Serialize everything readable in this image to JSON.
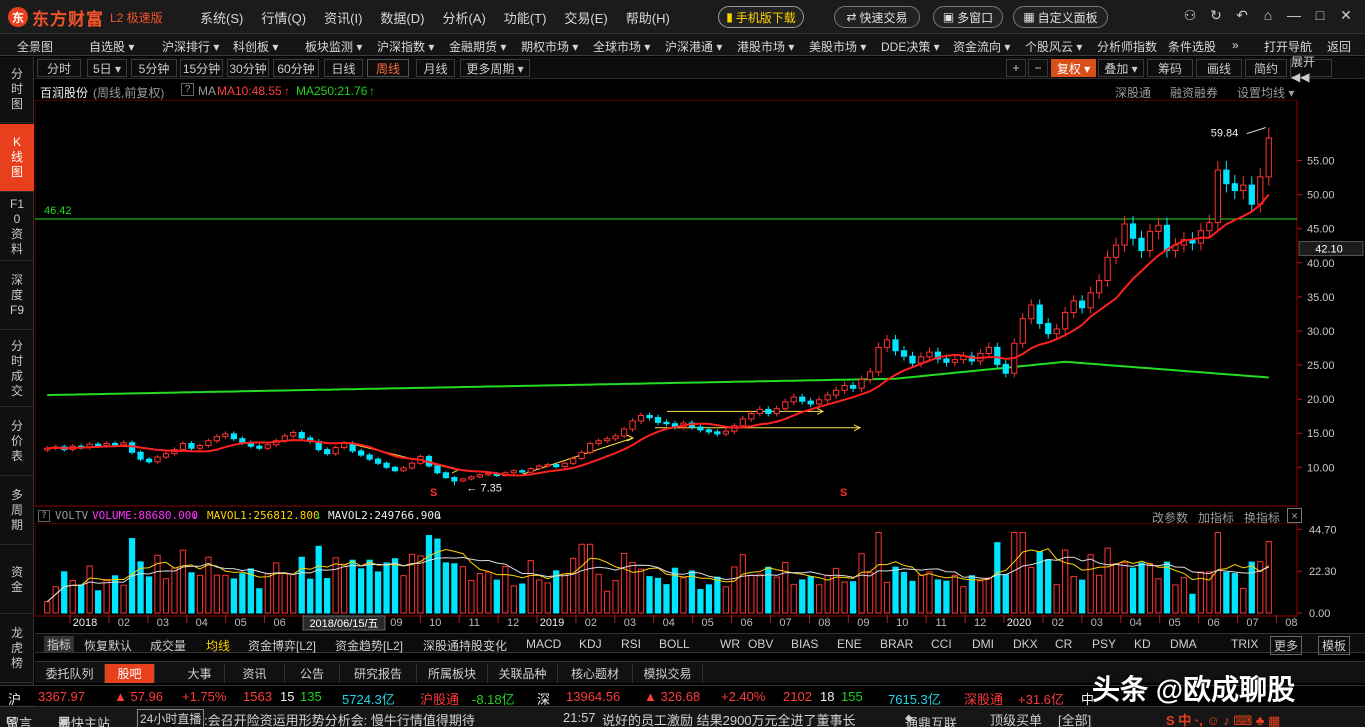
{
  "app": {
    "logo_mark": "东",
    "name": "东方财富",
    "version": "L2 极速版"
  },
  "top_menu": [
    "系统(S)",
    "行情(Q)",
    "资讯(I)",
    "数据(D)",
    "分析(A)",
    "功能(T)",
    "交易(E)",
    "帮助(H)"
  ],
  "top_buttons": {
    "mobile": "手机版下载",
    "quick_trade": "快速交易",
    "multi_window": "多窗口",
    "custom_panel": "自定义面板"
  },
  "window_icons": [
    "user-icon",
    "refresh-icon",
    "back-icon",
    "shirt-icon",
    "minimize-icon",
    "maximize-icon",
    "close-icon"
  ],
  "nav_menu": [
    {
      "label": "全景图",
      "x": 17
    },
    {
      "label": "自选股 ▾",
      "x": 89
    },
    {
      "label": "沪深排行 ▾",
      "x": 162
    },
    {
      "label": "科创板 ▾",
      "x": 233
    },
    {
      "label": "板块监测 ▾",
      "x": 305
    },
    {
      "label": "沪深指数 ▾",
      "x": 377
    },
    {
      "label": "金融期货 ▾",
      "x": 449
    },
    {
      "label": "期权市场 ▾",
      "x": 521
    },
    {
      "label": "全球市场 ▾",
      "x": 593
    },
    {
      "label": "沪深港通 ▾",
      "x": 665
    },
    {
      "label": "港股市场 ▾",
      "x": 737
    },
    {
      "label": "美股市场 ▾",
      "x": 809
    },
    {
      "label": "DDE决策 ▾",
      "x": 881
    },
    {
      "label": "资金流向 ▾",
      "x": 953
    },
    {
      "label": "个股风云 ▾",
      "x": 1025
    },
    {
      "label": "分析师指数",
      "x": 1097
    },
    {
      "label": "条件选股",
      "x": 1168
    },
    {
      "label": "»",
      "x": 1232
    },
    {
      "label": "打开导航",
      "x": 1264
    },
    {
      "label": "返回",
      "x": 1327
    }
  ],
  "left_tabs": [
    "分时图",
    "K线图",
    "F10资料",
    "深度F9",
    "分时成交",
    "分价表",
    "多周期",
    "资金",
    "龙虎榜"
  ],
  "period_bar": {
    "periods": [
      "分时",
      "5日 ▾",
      "5分钟",
      "15分钟",
      "30分钟",
      "60分钟",
      "日线",
      "周线",
      "月线",
      "更多周期 ▾"
    ],
    "active": "周线",
    "right_tools": [
      "+",
      "−",
      "复权 ▾",
      "叠加 ▾",
      "筹码",
      "画线",
      "简约",
      "展开 ◀◀"
    ]
  },
  "chart_header": {
    "stock": "百润股份",
    "mode": "(周线,前复权)",
    "help": "?",
    "ma_label": "MA",
    "ma10": "MA10:48.55",
    "ma250": "MA250:21.76",
    "links": [
      "深股通",
      "融资融券",
      "设置均线 ▾"
    ]
  },
  "annotations": {
    "high_label": "59.84",
    "low_label": "7.35",
    "hline_label": "46.42",
    "current_price": "42.10",
    "s_marker": "S"
  },
  "vol_header": {
    "help": "?",
    "name": "VOLTV",
    "volume": "VOLUME:88680.000",
    "mavol1": "MAVOL1:256812.800",
    "mavol2": "MAVOL2:249766.900",
    "links": [
      "改参数",
      "加指标",
      "换指标"
    ],
    "close": "✕"
  },
  "tooltip_date": "2018/06/15/五",
  "indicator_bar": {
    "items": [
      "指标",
      "恢复默认",
      "成交量",
      "均线",
      "资金博弈[L2]",
      "资金趋势[L2]",
      "深股通持股变化",
      "MACD",
      "KDJ",
      "RSI",
      "BOLL",
      "WR",
      "OBV",
      "BIAS",
      "ENE",
      "BRAR",
      "CCI",
      "DMI",
      "DKX",
      "CR",
      "PSY",
      "KD",
      "DMA",
      "TRIX",
      "更多",
      "模板"
    ]
  },
  "bottom_tabs": [
    "委托队列",
    "股吧",
    "大事",
    "资讯",
    "公告",
    "研究报告",
    "所属板块",
    "关联品种",
    "核心题材",
    "模拟交易"
  ],
  "bottom_active": "股吧",
  "index_strip": {
    "sh_label": "沪",
    "sh_price": "3367.97",
    "sh_change": "▲ 57.96",
    "sh_pct": "+1.75%",
    "sh_up": "1563",
    "sh_flat": "15",
    "sh_down": "135",
    "sh_amount": "5724.3亿",
    "hgt_label": "沪股通",
    "hgt_value": "-8.18亿",
    "sz_label": "深",
    "sz_price": "13964.56",
    "sz_change": "▲ 326.68",
    "sz_pct": "+2.40%",
    "sz_up": "2102",
    "sz_flat": "18",
    "sz_down": "155",
    "sz_amount": "7615.3亿",
    "sgt_label": "深股通",
    "sgt_value": "+31.6亿",
    "zh_label": "中"
  },
  "status": {
    "leave_msg": "留言",
    "top_site": "最快主站",
    "live": "24小时直播",
    "news1": ":会召开险资运用形势分析会: 慢牛行情值得期待",
    "time": "21:57",
    "news2": "说好的员工激励 结果2900万元全进了董事长",
    "broker": "通鼎互联",
    "top_buy": "顶级买单",
    "filter": "[全部]"
  },
  "watermark": "头条 @欧成聊股",
  "colors": {
    "up": "#ff3232",
    "down": "#00e5ff",
    "ma10": "#ff2020",
    "ma250": "#22dd22",
    "accent": "#e8401c"
  },
  "chart_data": {
    "type": "candlestick",
    "title": "百润股份 (周线,前复权)",
    "period": "weekly",
    "price_axis": {
      "ticks": [
        10,
        15,
        20,
        25,
        30,
        35,
        40,
        45,
        50,
        55
      ],
      "ylim": [
        5.5,
        63
      ]
    },
    "volume_axis": {
      "ticks": [
        "0.00",
        "22.30",
        "44.70"
      ],
      "ylim": [
        0,
        47
      ]
    },
    "x_ticks": [
      "2018",
      "02",
      "03",
      "04",
      "05",
      "06",
      "07",
      "08",
      "09",
      "10",
      "11",
      "12",
      "2019",
      "02",
      "03",
      "04",
      "05",
      "06",
      "07",
      "08",
      "09",
      "10",
      "11",
      "12",
      "2020",
      "02",
      "03",
      "04",
      "05",
      "06",
      "07",
      "08"
    ],
    "highest": 59.84,
    "lowest": 7.35,
    "horizontal_line": 46.42,
    "last_price": 42.1,
    "ma10_last": 48.55,
    "ma250_last": 21.76,
    "series_closes": [
      12.8,
      13.0,
      12.6,
      13.1,
      12.9,
      13.4,
      13.2,
      13.5,
      13.3,
      13.6,
      12.2,
      11.2,
      10.8,
      11.5,
      12.0,
      12.6,
      13.5,
      12.8,
      13.2,
      13.9,
      14.5,
      14.9,
      14.2,
      13.6,
      13.1,
      12.8,
      13.3,
      13.9,
      14.6,
      15.1,
      14.3,
      13.8,
      12.6,
      12.0,
      12.9,
      13.5,
      12.4,
      11.8,
      11.2,
      10.6,
      10.0,
      9.5,
      9.9,
      10.6,
      11.6,
      10.2,
      9.2,
      8.5,
      8.0,
      8.3,
      8.6,
      8.9,
      9.1,
      8.8,
      9.2,
      9.5,
      9.3,
      9.8,
      10.2,
      10.4,
      10.1,
      10.6,
      11.3,
      12.2,
      13.5,
      13.9,
      14.2,
      14.6,
      15.6,
      16.8,
      17.6,
      17.3,
      16.6,
      16.4,
      15.9,
      16.5,
      15.9,
      15.5,
      15.2,
      14.9,
      15.3,
      16.1,
      17.1,
      17.9,
      18.5,
      17.9,
      18.6,
      19.6,
      20.3,
      19.7,
      19.3,
      19.9,
      20.6,
      21.3,
      22.0,
      21.6,
      22.9,
      24.0,
      27.6,
      28.7,
      27.1,
      26.3,
      25.3,
      26.2,
      26.9,
      25.9,
      25.4,
      25.8,
      26.3,
      25.6,
      26.7,
      27.6,
      25.1,
      23.8,
      28.2,
      31.8,
      33.8,
      31.1,
      29.6,
      30.3,
      32.7,
      34.4,
      33.4,
      35.6,
      37.4,
      40.8,
      42.6,
      45.7,
      43.6,
      41.8,
      44.6,
      45.5,
      41.8,
      42.6,
      43.4,
      42.9,
      44.7,
      45.9,
      53.6,
      51.6,
      50.6,
      51.4,
      48.6,
      52.6,
      58.3
    ]
  }
}
